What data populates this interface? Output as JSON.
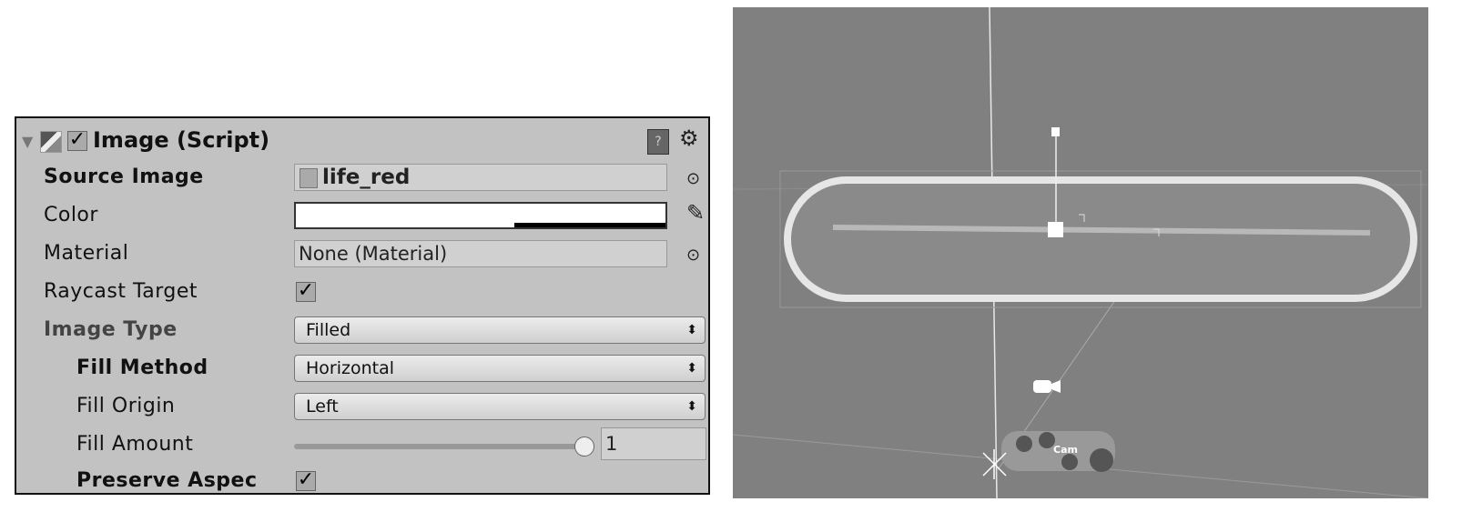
{
  "component": {
    "title": "Image (Script)",
    "enabled": true,
    "fields": {
      "source_image": {
        "label": "Source Image",
        "value": "life_red"
      },
      "color": {
        "label": "Color",
        "value": "#ffffff",
        "alpha_bar": "#000000"
      },
      "material": {
        "label": "Material",
        "value": "None (Material)"
      },
      "raycast_target": {
        "label": "Raycast Target",
        "checked": true
      },
      "image_type": {
        "label": "Image Type",
        "value": "Filled"
      },
      "fill_method": {
        "label": "Fill Method",
        "value": "Horizontal"
      },
      "fill_origin": {
        "label": "Fill Origin",
        "value": "Left"
      },
      "fill_amount": {
        "label": "Fill Amount",
        "value": "1",
        "fraction": 1.0
      },
      "preserve_aspect": {
        "label": "Preserve Aspec",
        "checked": true
      }
    }
  },
  "scene": {
    "camera_label": "Cam"
  }
}
